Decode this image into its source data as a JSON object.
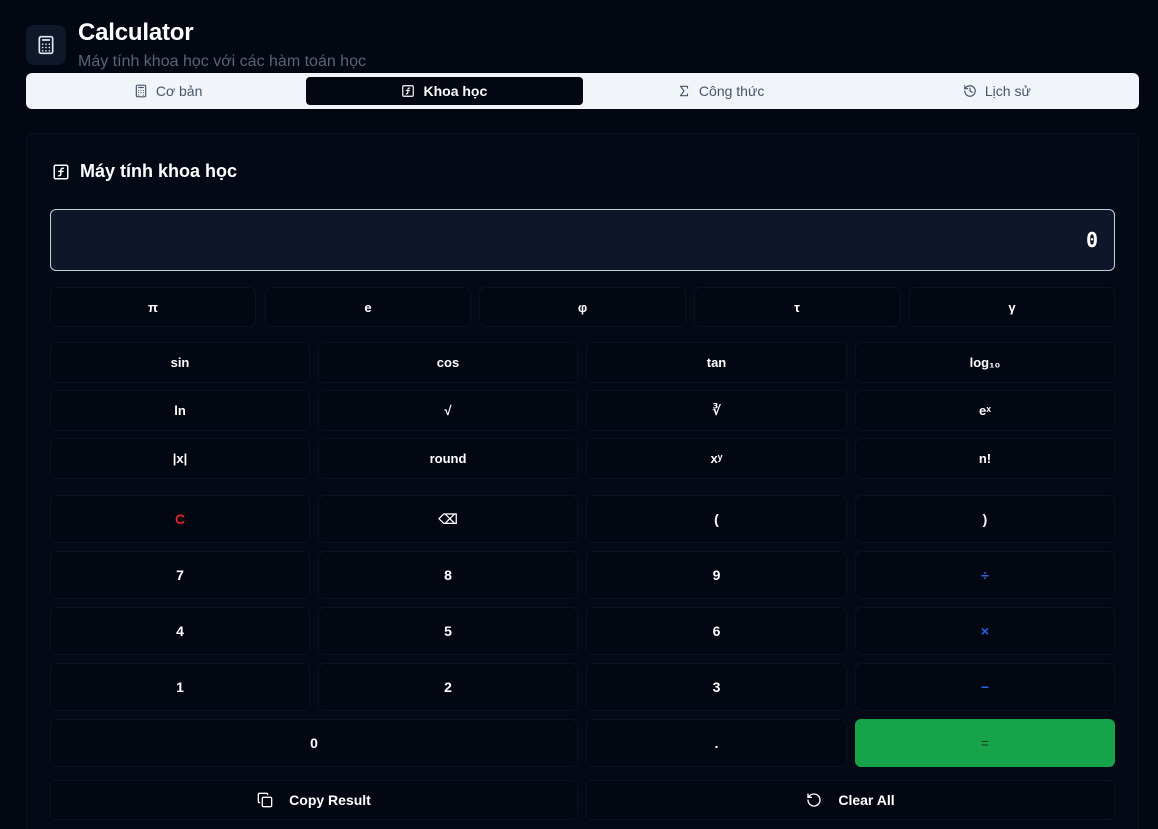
{
  "header": {
    "title": "Calculator",
    "subtitle": "Máy tính khoa học với các hàm toán học"
  },
  "tabs": [
    {
      "label": "Cơ bản",
      "icon": "calculator-icon"
    },
    {
      "label": "Khoa học",
      "icon": "function-icon",
      "active": true
    },
    {
      "label": "Công thức",
      "icon": "sigma-icon"
    },
    {
      "label": "Lịch sử",
      "icon": "history-icon"
    }
  ],
  "card": {
    "title": "Máy tính khoa học"
  },
  "display": {
    "value": "0"
  },
  "constants": [
    "π",
    "e",
    "φ",
    "τ",
    "γ"
  ],
  "functions": [
    [
      "sin",
      "cos",
      "tan",
      "log₁₀"
    ],
    [
      "ln",
      "√",
      "∛",
      "eˣ"
    ],
    [
      "|x|",
      "round",
      "xʸ",
      "n!"
    ]
  ],
  "keypad": {
    "clear": "C",
    "backspace": "⌫",
    "open_paren": "(",
    "close_paren": ")",
    "seven": "7",
    "eight": "8",
    "nine": "9",
    "divide": "÷",
    "four": "4",
    "five": "5",
    "six": "6",
    "multiply": "×",
    "one": "1",
    "two": "2",
    "three": "3",
    "minus": "−",
    "zero": "0",
    "dot": ".",
    "equals": "="
  },
  "actions": {
    "copy": "Copy Result",
    "clear_all": "Clear All"
  },
  "colors": {
    "background": "#020712",
    "equals_green": "#16a34a",
    "clear_red": "#dc2626",
    "operator_blue": "#2563eb"
  }
}
